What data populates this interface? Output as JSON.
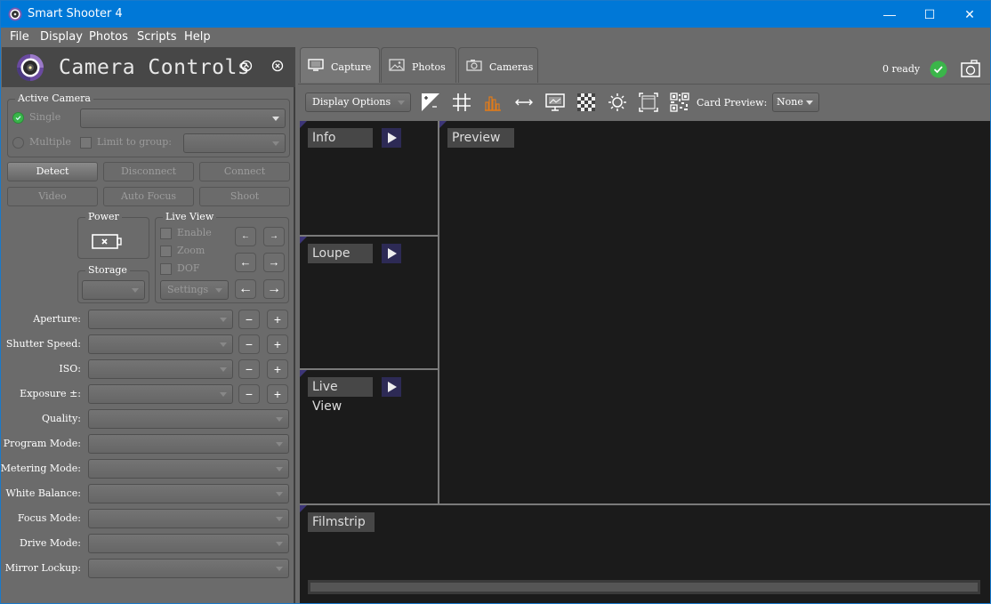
{
  "window": {
    "title": "Smart Shooter 4",
    "minimize": "—",
    "maximize": "☐",
    "close": "✕"
  },
  "menu": [
    "File",
    "Display",
    "Photos",
    "Scripts",
    "Help"
  ],
  "left_panel": {
    "title": "Camera Controls",
    "collapse_icon": "⌃",
    "close_icon": "⊗",
    "active_camera": {
      "label": "Active Camera",
      "single_label": "Single",
      "multiple_label": "Multiple",
      "limit_label": "Limit to group:",
      "single_selected": true
    },
    "buttons": {
      "detect": "Detect",
      "disconnect": "Disconnect",
      "connect": "Connect",
      "video": "Video",
      "auto_focus": "Auto Focus",
      "shoot": "Shoot"
    },
    "power": {
      "label": "Power"
    },
    "storage": {
      "label": "Storage"
    },
    "live_view": {
      "label": "Live View",
      "enable": "Enable",
      "zoom": "Zoom",
      "dof": "DOF",
      "settings": "Settings",
      "arrows": [
        "←",
        "→",
        "←",
        "→",
        "←",
        "→"
      ]
    },
    "settings": [
      {
        "label": "Aperture:",
        "stepper": true
      },
      {
        "label": "Shutter Speed:",
        "stepper": true
      },
      {
        "label": "ISO:",
        "stepper": true
      },
      {
        "label": "Exposure ±:",
        "stepper": true
      },
      {
        "label": "Quality:",
        "stepper": false
      },
      {
        "label": "Program Mode:",
        "stepper": false
      },
      {
        "label": "Metering Mode:",
        "stepper": false
      },
      {
        "label": "White Balance:",
        "stepper": false
      },
      {
        "label": "Focus Mode:",
        "stepper": false
      },
      {
        "label": "Drive Mode:",
        "stepper": false
      },
      {
        "label": "Mirror Lockup:",
        "stepper": false
      }
    ],
    "minus": "−",
    "plus": "+"
  },
  "tabs": [
    {
      "label": "Capture",
      "icon": "monitor-icon",
      "active": true
    },
    {
      "label": "Photos",
      "icon": "image-icon",
      "active": false
    },
    {
      "label": "Cameras",
      "icon": "camera-icon",
      "active": false
    }
  ],
  "status": {
    "ready_text": "0 ready"
  },
  "toolbar": {
    "display_options": "Display Options",
    "card_preview_label": "Card Preview:",
    "card_preview_value": "None",
    "highlight_color": "#e07b1a"
  },
  "panes": {
    "info": "Info",
    "loupe": "Loupe",
    "live_view": "Live View",
    "preview": "Preview",
    "filmstrip": "Filmstrip"
  }
}
